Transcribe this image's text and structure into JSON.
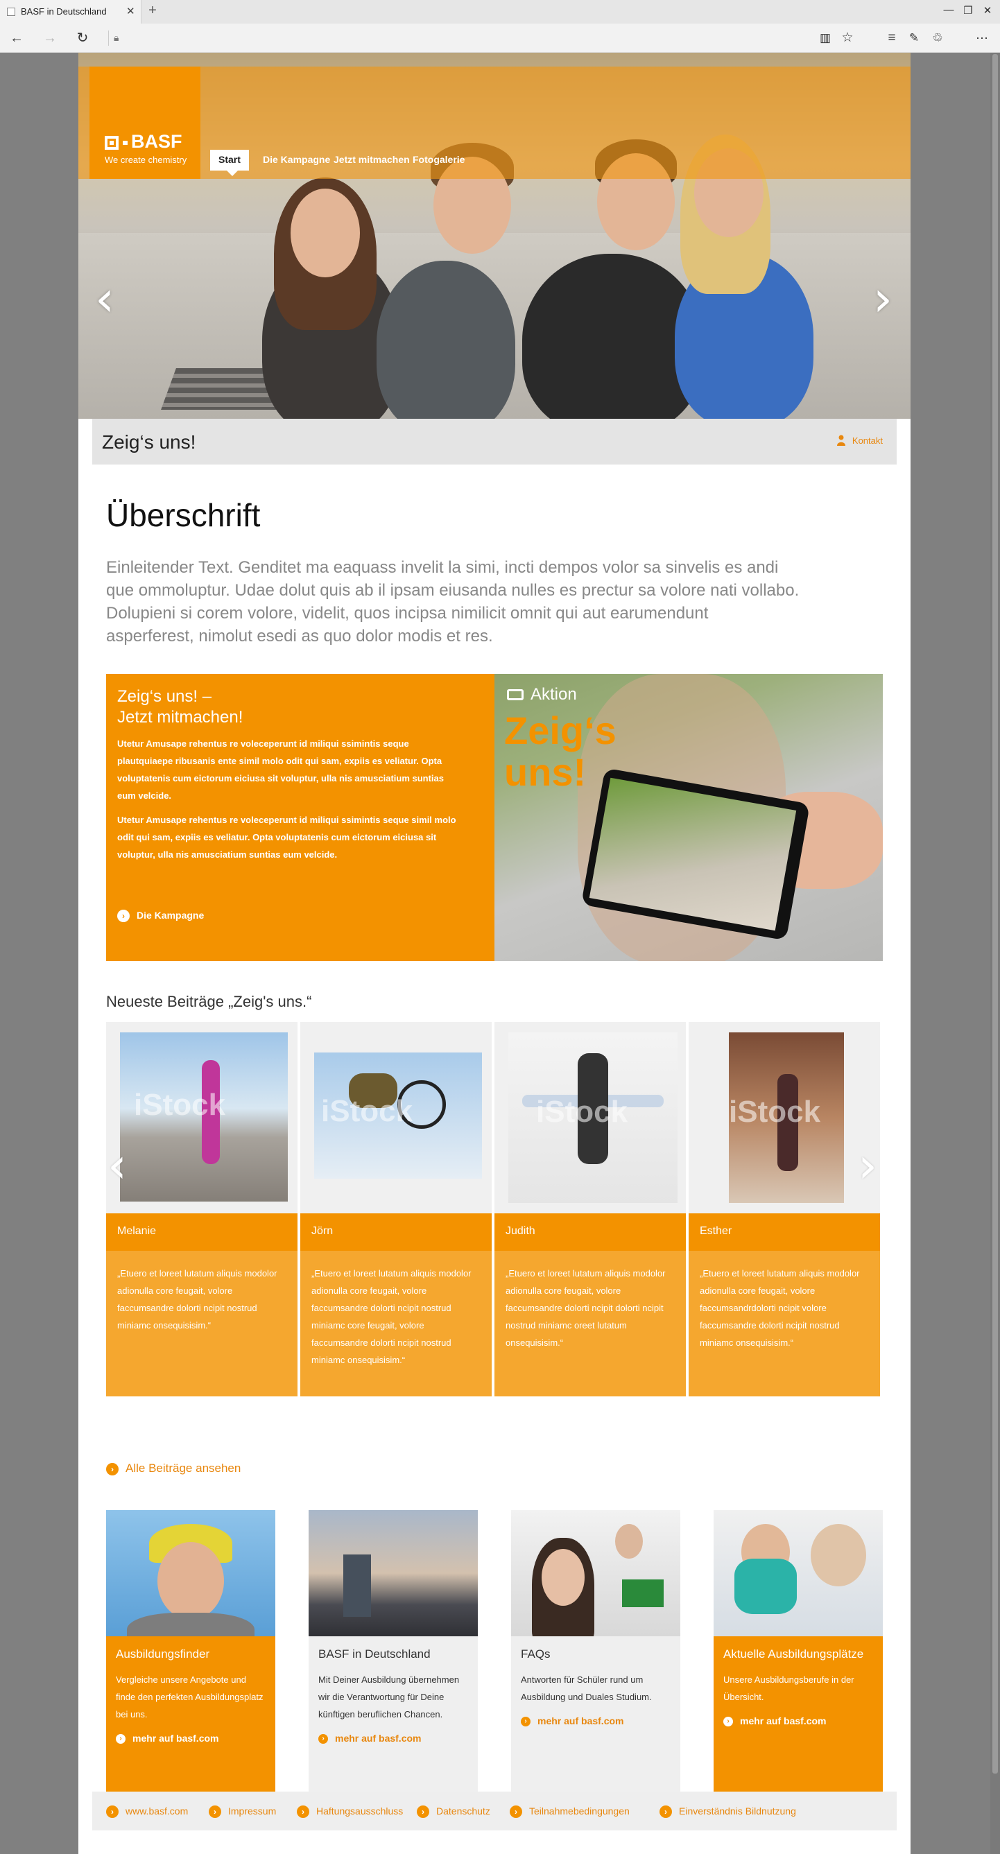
{
  "browser": {
    "tab_title": "BASF in Deutschland",
    "tab_close": "✕",
    "new_tab": "+",
    "win_min": "—",
    "win_max": "❐",
    "win_close": "✕"
  },
  "hero": {
    "logo_word": "BASF",
    "logo_tagline": "We create chemistry",
    "nav": [
      "Start",
      "Die Kampagne",
      "Jetzt mitmachen",
      "Fotogalerie"
    ],
    "prev_arrow": "‹",
    "next_arrow": "›"
  },
  "titlebar": {
    "title": "Zeig‘s uns!",
    "contact": "Kontakt"
  },
  "intro": {
    "heading": "Überschrift",
    "lead": "Einleitender Text. Genditet ma eaquass invelit la simi, incti dempos volor sa sinvelis es andi que ommoluptur. Udae dolut quis ab il ipsam eiusanda nulles es prectur sa volore nati vollabo. Dolupieni si corem volore, videlit, quos incipsa nimilicit omnit qui aut earumendunt asperferest, nimolut esedi as quo dolor modis et res."
  },
  "teaser": {
    "heading_line1": "Zeig‘s uns! –",
    "heading_line2": "Jetzt mitmachen!",
    "para1": "Utetur Amusape rehentus re voleceperunt id miliqui ssimintis seque plautquiaepe ribusanis ente simil molo odit qui sam, expiis es veliatur. Opta voluptatenis cum eictorum eiciusa sit voluptur, ulla nis amusciatium suntias eum velcide.",
    "para2": "Utetur Amusape rehentus re voleceperunt id miliqui ssimintis seque simil molo odit qui sam, expiis es veliatur. Opta voluptatenis cum eictorum eiciusa sit voluptur, ulla nis amusciatium suntias eum velcide.",
    "link": "Die Kampagne",
    "aktion_label": "Aktion",
    "aktion_big_line1": "Zeig‘s",
    "aktion_big_line2": "uns!"
  },
  "posts": {
    "title": "Neueste Beiträge „Zeig's uns.“",
    "watermark": "iStock",
    "items": [
      {
        "name": "Melanie",
        "quote": "„Etuero et loreet lutatum aliquis modolor adionulla core feugait, volore faccumsandre dolorti ncipit nostrud miniamc onsequisisim.“"
      },
      {
        "name": "Jörn",
        "quote": "„Etuero et loreet lutatum aliquis modolor adionulla core feugait, volore faccumsandre dolorti ncipit nostrud miniamc core feugait, volore faccumsandre dolorti ncipit nostrud miniamc onsequisisim.“"
      },
      {
        "name": "Judith",
        "quote": "„Etuero et loreet lutatum aliquis modolor adionulla core feugait, volore faccumsandre dolorti ncipit dolorti ncipit nostrud miniamc oreet lutatum onsequisisim.“"
      },
      {
        "name": "Esther",
        "quote": "„Etuero et loreet lutatum aliquis modolor adionulla core feugait, volore faccumsandrdolorti ncipit volore faccumsandre dolorti ncipit nostrud miniamc onsequisisim.“"
      }
    ],
    "all_link": "Alle Beiträge ansehen"
  },
  "boxes": [
    {
      "title": "Ausbildungsfinder",
      "text": "Vergleiche unsere Angebote und finde den perfekten Ausbildungsplatz bei uns.",
      "link": "mehr auf basf.com",
      "style": "orange"
    },
    {
      "title": "BASF in Deutschland",
      "text": "Mit Deiner Ausbildung übernehmen wir die Verantwortung für Deine künftigen beruflichen Chancen.",
      "link": "mehr auf basf.com",
      "style": "grey"
    },
    {
      "title": "FAQs",
      "text": "Antworten für Schüler rund um Ausbildung und Duales Studium.",
      "link": "mehr auf basf.com",
      "style": "grey"
    },
    {
      "title": "Aktuelle Ausbildungsplätze",
      "text": "Unsere Ausbildungsberufe in der Übersicht.",
      "link": "mehr auf basf.com",
      "style": "orange"
    }
  ],
  "footer": [
    "www.basf.com",
    "Impressum",
    "Haftungsausschluss",
    "Datenschutz",
    "Teilnahmebedingungen",
    "Einverständnis Bildnutzung"
  ],
  "colors": {
    "accent": "#f39200",
    "accent_light": "#f5a72f",
    "link": "#e8870e"
  }
}
